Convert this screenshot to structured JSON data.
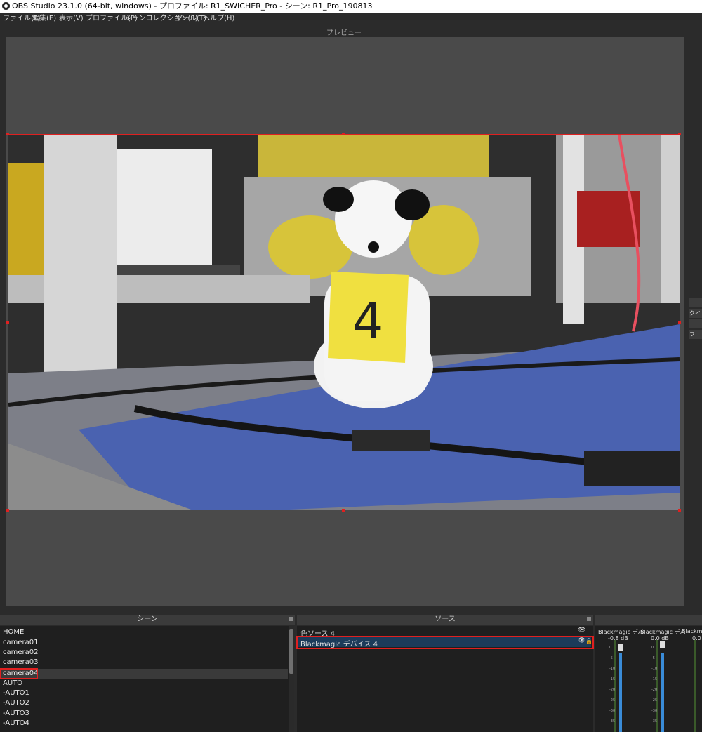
{
  "window": {
    "title": "OBS Studio 23.1.0 (64-bit, windows) - プロファイル: R1_SWICHER_Pro - シーン: R1_Pro_190813"
  },
  "menu": [
    "ファイル(F)",
    "編集(E)",
    "表示(V)",
    "プロファイル(P)",
    "シーンコレクション(S)",
    "ツール(T)",
    "ヘルプ(H)"
  ],
  "preview": {
    "label": "プレビュー",
    "side_buttons": [
      "",
      "クイッ",
      "",
      "フ"
    ]
  },
  "scenes": {
    "header": "シーン",
    "items": [
      "HOME",
      "camera01",
      "camera02",
      "camera03",
      "camera04",
      "AUTO",
      "-AUTO1",
      "-AUTO2",
      "-AUTO3",
      "-AUTO4"
    ],
    "selected": "camera04"
  },
  "sources": {
    "header": "ソース",
    "items": [
      "色ソース 4",
      "Blackmagic デバイス 4"
    ],
    "selected": "Blackmagic デバイス 4"
  },
  "mixer": {
    "channels": [
      {
        "name": "Blackmagic デバ",
        "db": "-0.8 dB"
      },
      {
        "name": "Blackmagic デバ",
        "db": "0.0 dB"
      },
      {
        "name": "Blackmagic",
        "db": "0.0"
      }
    ],
    "scale": [
      "0",
      "-5",
      "-10",
      "-15",
      "-20",
      "-25",
      "-30",
      "-35",
      "-40",
      "-45"
    ]
  },
  "photo": {
    "sign_text": "4"
  },
  "colors": {
    "highlight_red": "#e02020",
    "selection_blue": "#1c3b5a"
  }
}
